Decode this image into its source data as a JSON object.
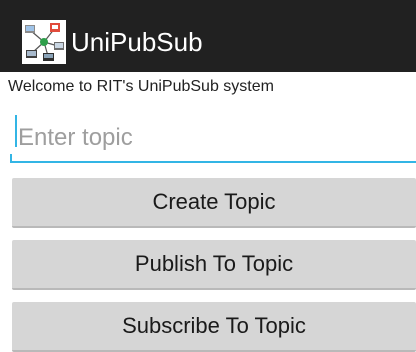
{
  "action_bar": {
    "title": "UniPubSub",
    "icon": "network-hub-icon",
    "background": "#212121"
  },
  "main": {
    "welcome_text": "Welcome to RIT's UniPubSub system",
    "topic_input": {
      "value": "",
      "placeholder": "Enter topic"
    },
    "buttons": {
      "create": "Create Topic",
      "publish": "Publish To Topic",
      "subscribe": "Subscribe To Topic"
    }
  },
  "colors": {
    "accent": "#33b5e5",
    "button_bg": "#d6d6d6"
  }
}
